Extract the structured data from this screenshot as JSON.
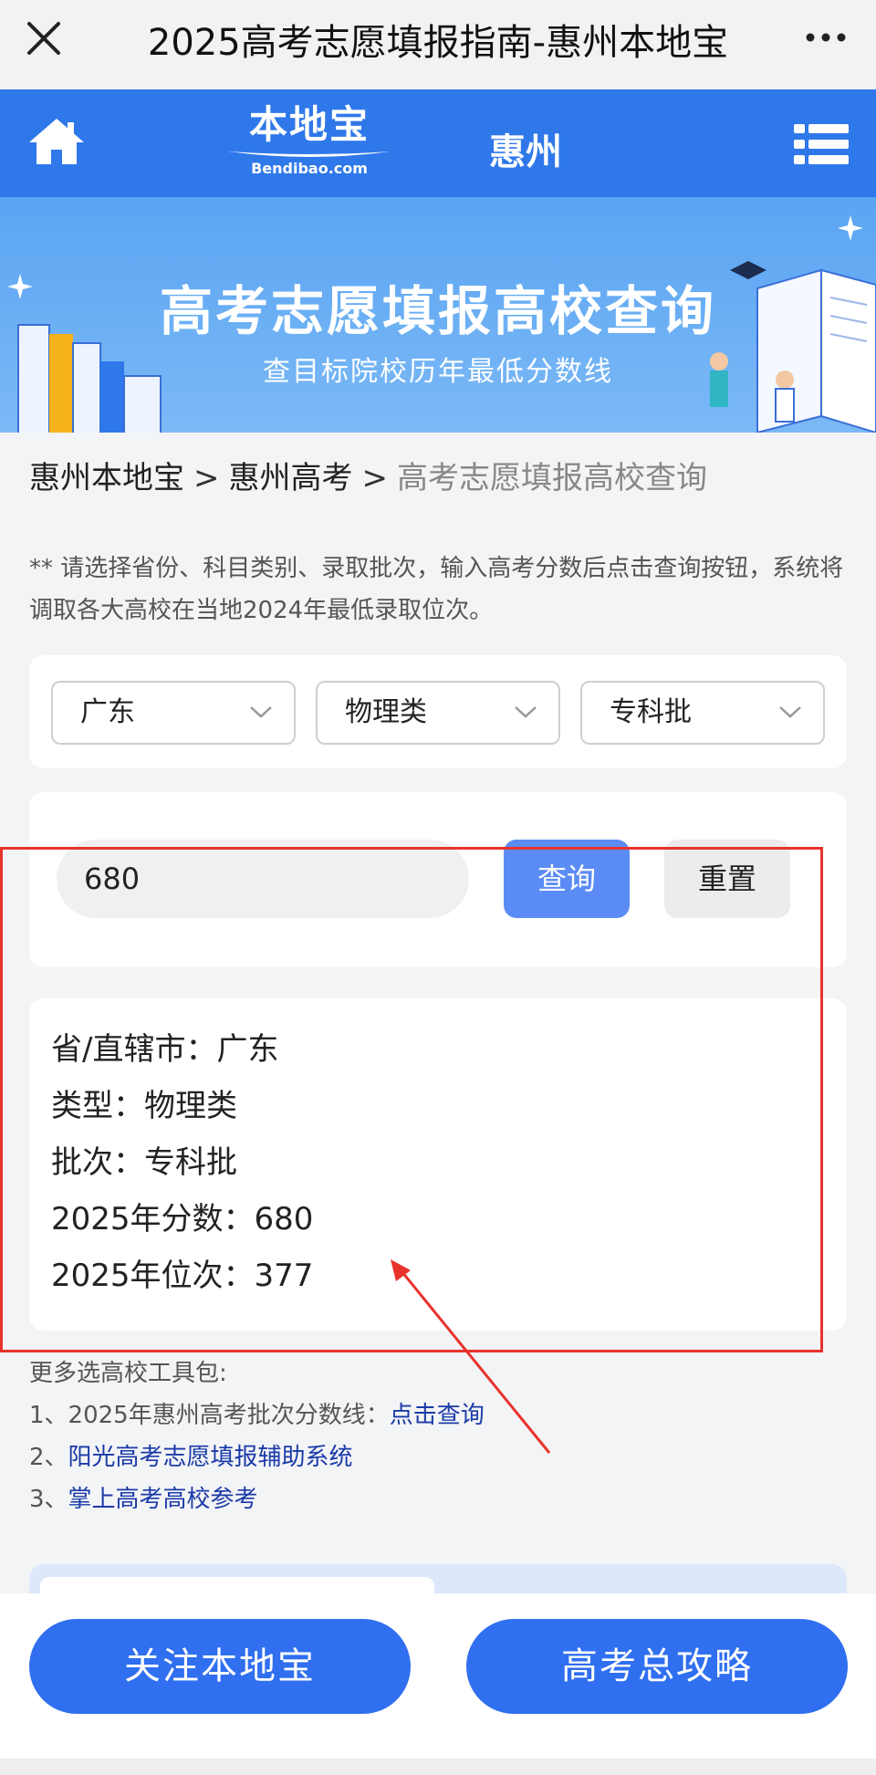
{
  "window": {
    "title": "2025高考志愿填报指南-惠州本地宝"
  },
  "header": {
    "logo_cn": "本地宝",
    "logo_en": "Bendibao.com",
    "city": "惠州"
  },
  "banner": {
    "title": "高考志愿填报高校查询",
    "subtitle": "查目标院校历年最低分数线"
  },
  "breadcrumb": {
    "items": [
      "惠州本地宝",
      "惠州高考",
      "高考志愿填报高校查询"
    ],
    "separator": ">"
  },
  "note": "** 请选择省份、科目类别、录取批次，输入高考分数后点击查询按钮，系统将调取各大高校在当地2024年最低录取位次。",
  "filters": {
    "province": "广东",
    "subject": "物理类",
    "batch": "专科批"
  },
  "search": {
    "score_value": "680",
    "query_label": "查询",
    "reset_label": "重置"
  },
  "result": {
    "province": "省/直辖市：广东",
    "type": "类型：物理类",
    "batch": "批次：专科批",
    "score": "2025年分数：680",
    "rank": "2025年位次：377"
  },
  "tools": {
    "heading": "更多选高校工具包:",
    "item1_prefix": "1、2025年惠州高考批次分数线：",
    "item1_link": "点击查询",
    "item2_prefix": "2、",
    "item2_link": "阳光高考志愿填报辅助系统",
    "item3_prefix": "3、",
    "item3_link": "掌上高考高校参考"
  },
  "bottom": {
    "follow_label": "关注本地宝",
    "guide_label": "高考总攻略"
  },
  "colors": {
    "header_blue": "#2f78ea",
    "query_button": "#5b8cf5",
    "highlight_red": "#e8332c",
    "link_blue": "#1a3aa8"
  }
}
